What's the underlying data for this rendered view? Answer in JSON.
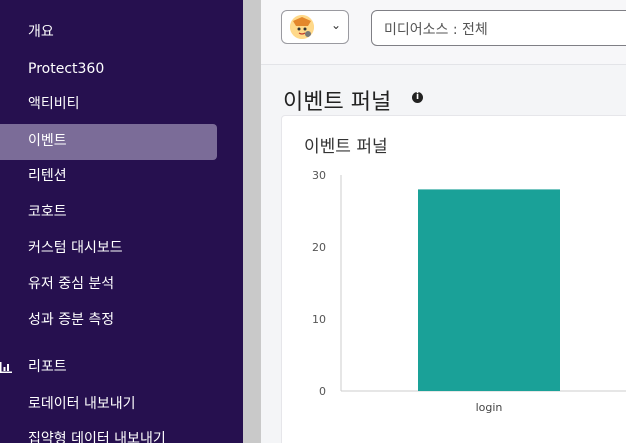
{
  "sidebar": {
    "items": [
      {
        "name": "overview",
        "label": "개요"
      },
      {
        "name": "protect360",
        "label": "Protect360"
      },
      {
        "name": "activity",
        "label": "액티비티"
      },
      {
        "name": "events",
        "label": "이벤트"
      },
      {
        "name": "retention",
        "label": "리텐션"
      },
      {
        "name": "cohort",
        "label": "코호트"
      },
      {
        "name": "custom-dashboard",
        "label": "커스텀 대시보드"
      },
      {
        "name": "user-centric-analysis",
        "label": "유저 중심 분석"
      },
      {
        "name": "incrementality",
        "label": "성과 증분 측정"
      }
    ],
    "active_item": "events",
    "reports_label": "리포트",
    "report_items": [
      {
        "name": "raw-data-export",
        "label": "로데이터 내보내기"
      },
      {
        "name": "aggregated-data-export",
        "label": "집약형 데이터 내보내기"
      }
    ]
  },
  "toolbar": {
    "media_source_label": "미디어소스 : 전체"
  },
  "page": {
    "title": "이벤트 퍼널"
  },
  "card": {
    "title": "이벤트 퍼널"
  },
  "colors": {
    "sidebar_bg": "#26104f",
    "active_bg": "#7b6c98",
    "bar": "#1aa198"
  },
  "chart_data": {
    "type": "bar",
    "title": "이벤트 퍼널",
    "categories": [
      "login"
    ],
    "values": [
      28
    ],
    "ylim": [
      0,
      30
    ],
    "yticks": [
      0,
      10,
      20,
      30
    ],
    "grid": false
  }
}
